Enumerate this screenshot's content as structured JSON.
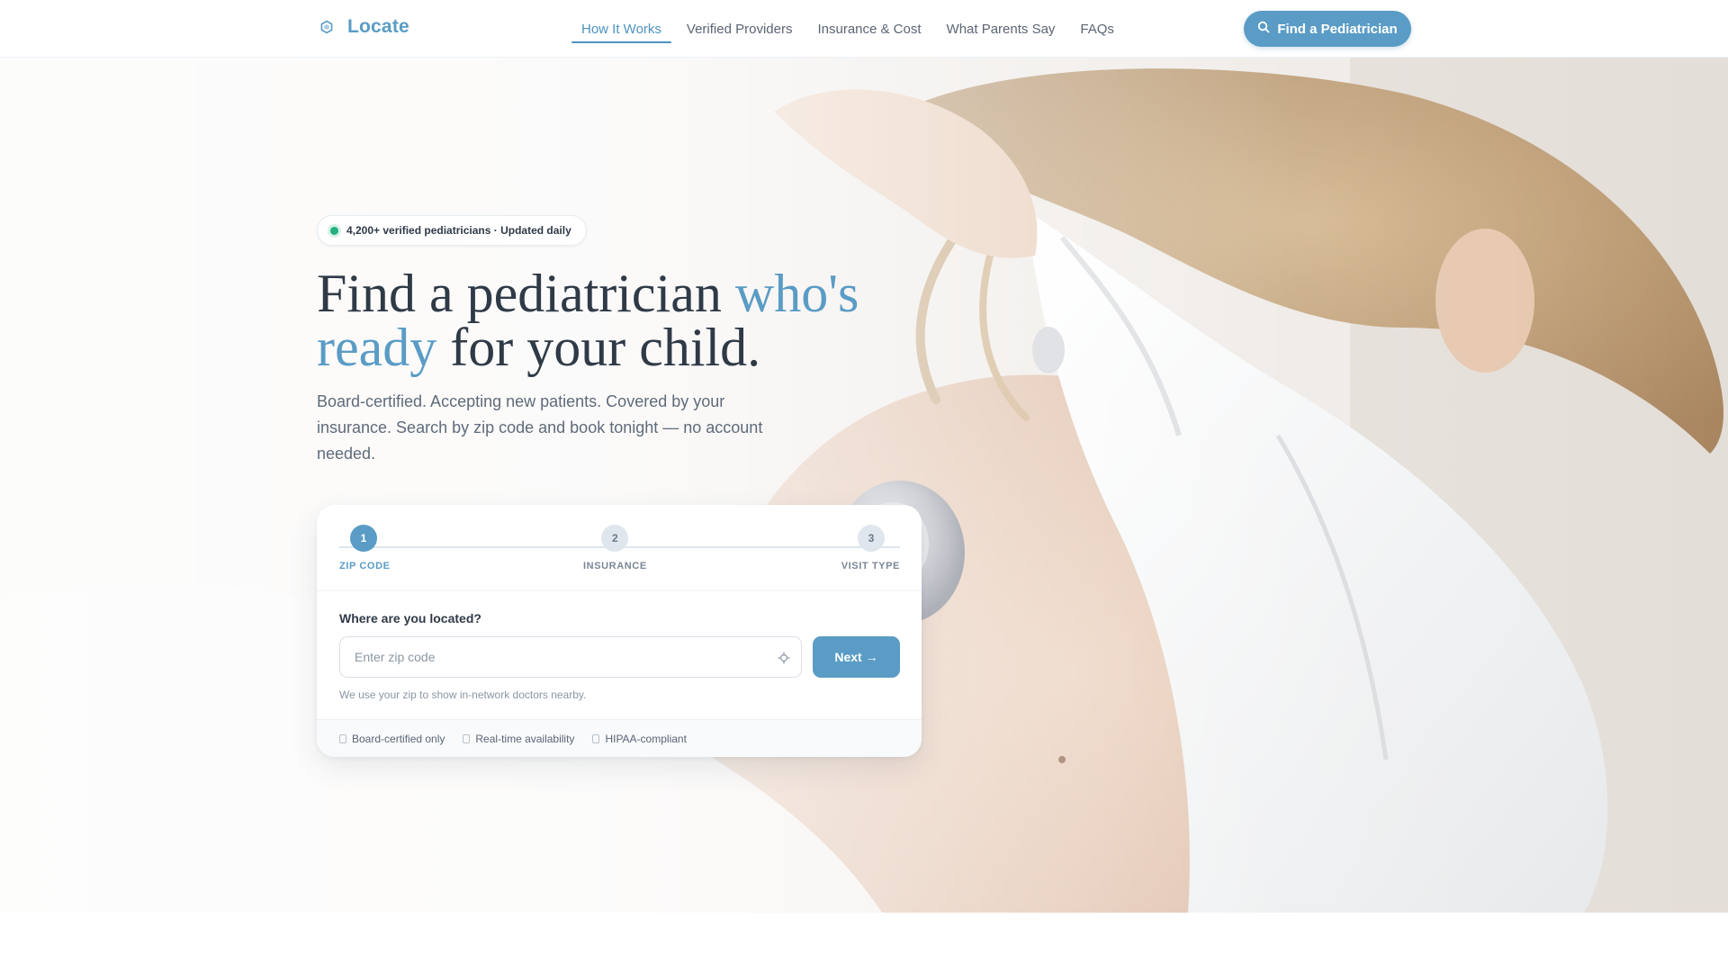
{
  "brand": {
    "name": "Locate",
    "icon": "hexagon-logo-icon",
    "color": "#5a9cc5"
  },
  "nav": {
    "items": [
      {
        "label": "How It Works",
        "active": true
      },
      {
        "label": "Verified Providers",
        "active": false
      },
      {
        "label": "Insurance & Cost",
        "active": false
      },
      {
        "label": "What Parents Say",
        "active": false
      },
      {
        "label": "FAQs",
        "active": false
      }
    ],
    "cta_label": "Find a Pediatrician",
    "cta_icon": "search-icon"
  },
  "hero": {
    "badge": "4,200+ verified pediatricians · Updated daily",
    "headline": {
      "part1": "Find a pediatrician ",
      "accent": "who's ready",
      "part2": " for your child."
    },
    "subtext": "Board-certified. Accepting new patients. Covered by your insurance. Search by zip code and book tonight — no account needed."
  },
  "search": {
    "steps": [
      {
        "number": "1",
        "label": "ZIP CODE",
        "active": true
      },
      {
        "number": "2",
        "label": "INSURANCE",
        "active": false
      },
      {
        "number": "3",
        "label": "VISIT TYPE",
        "active": false
      }
    ],
    "question": "Where are you located?",
    "zip_placeholder": "Enter zip code",
    "zip_value": "",
    "locate_icon": "crosshair-icon",
    "next_label": "Next →",
    "hint": "We use your zip to show in-network doctors nearby.",
    "features": [
      "Board-certified only",
      "Real-time availability",
      "HIPAA-compliant"
    ]
  },
  "colors": {
    "accent": "#5a9cc5",
    "text": "#2f3a47",
    "success": "#22b07d"
  }
}
